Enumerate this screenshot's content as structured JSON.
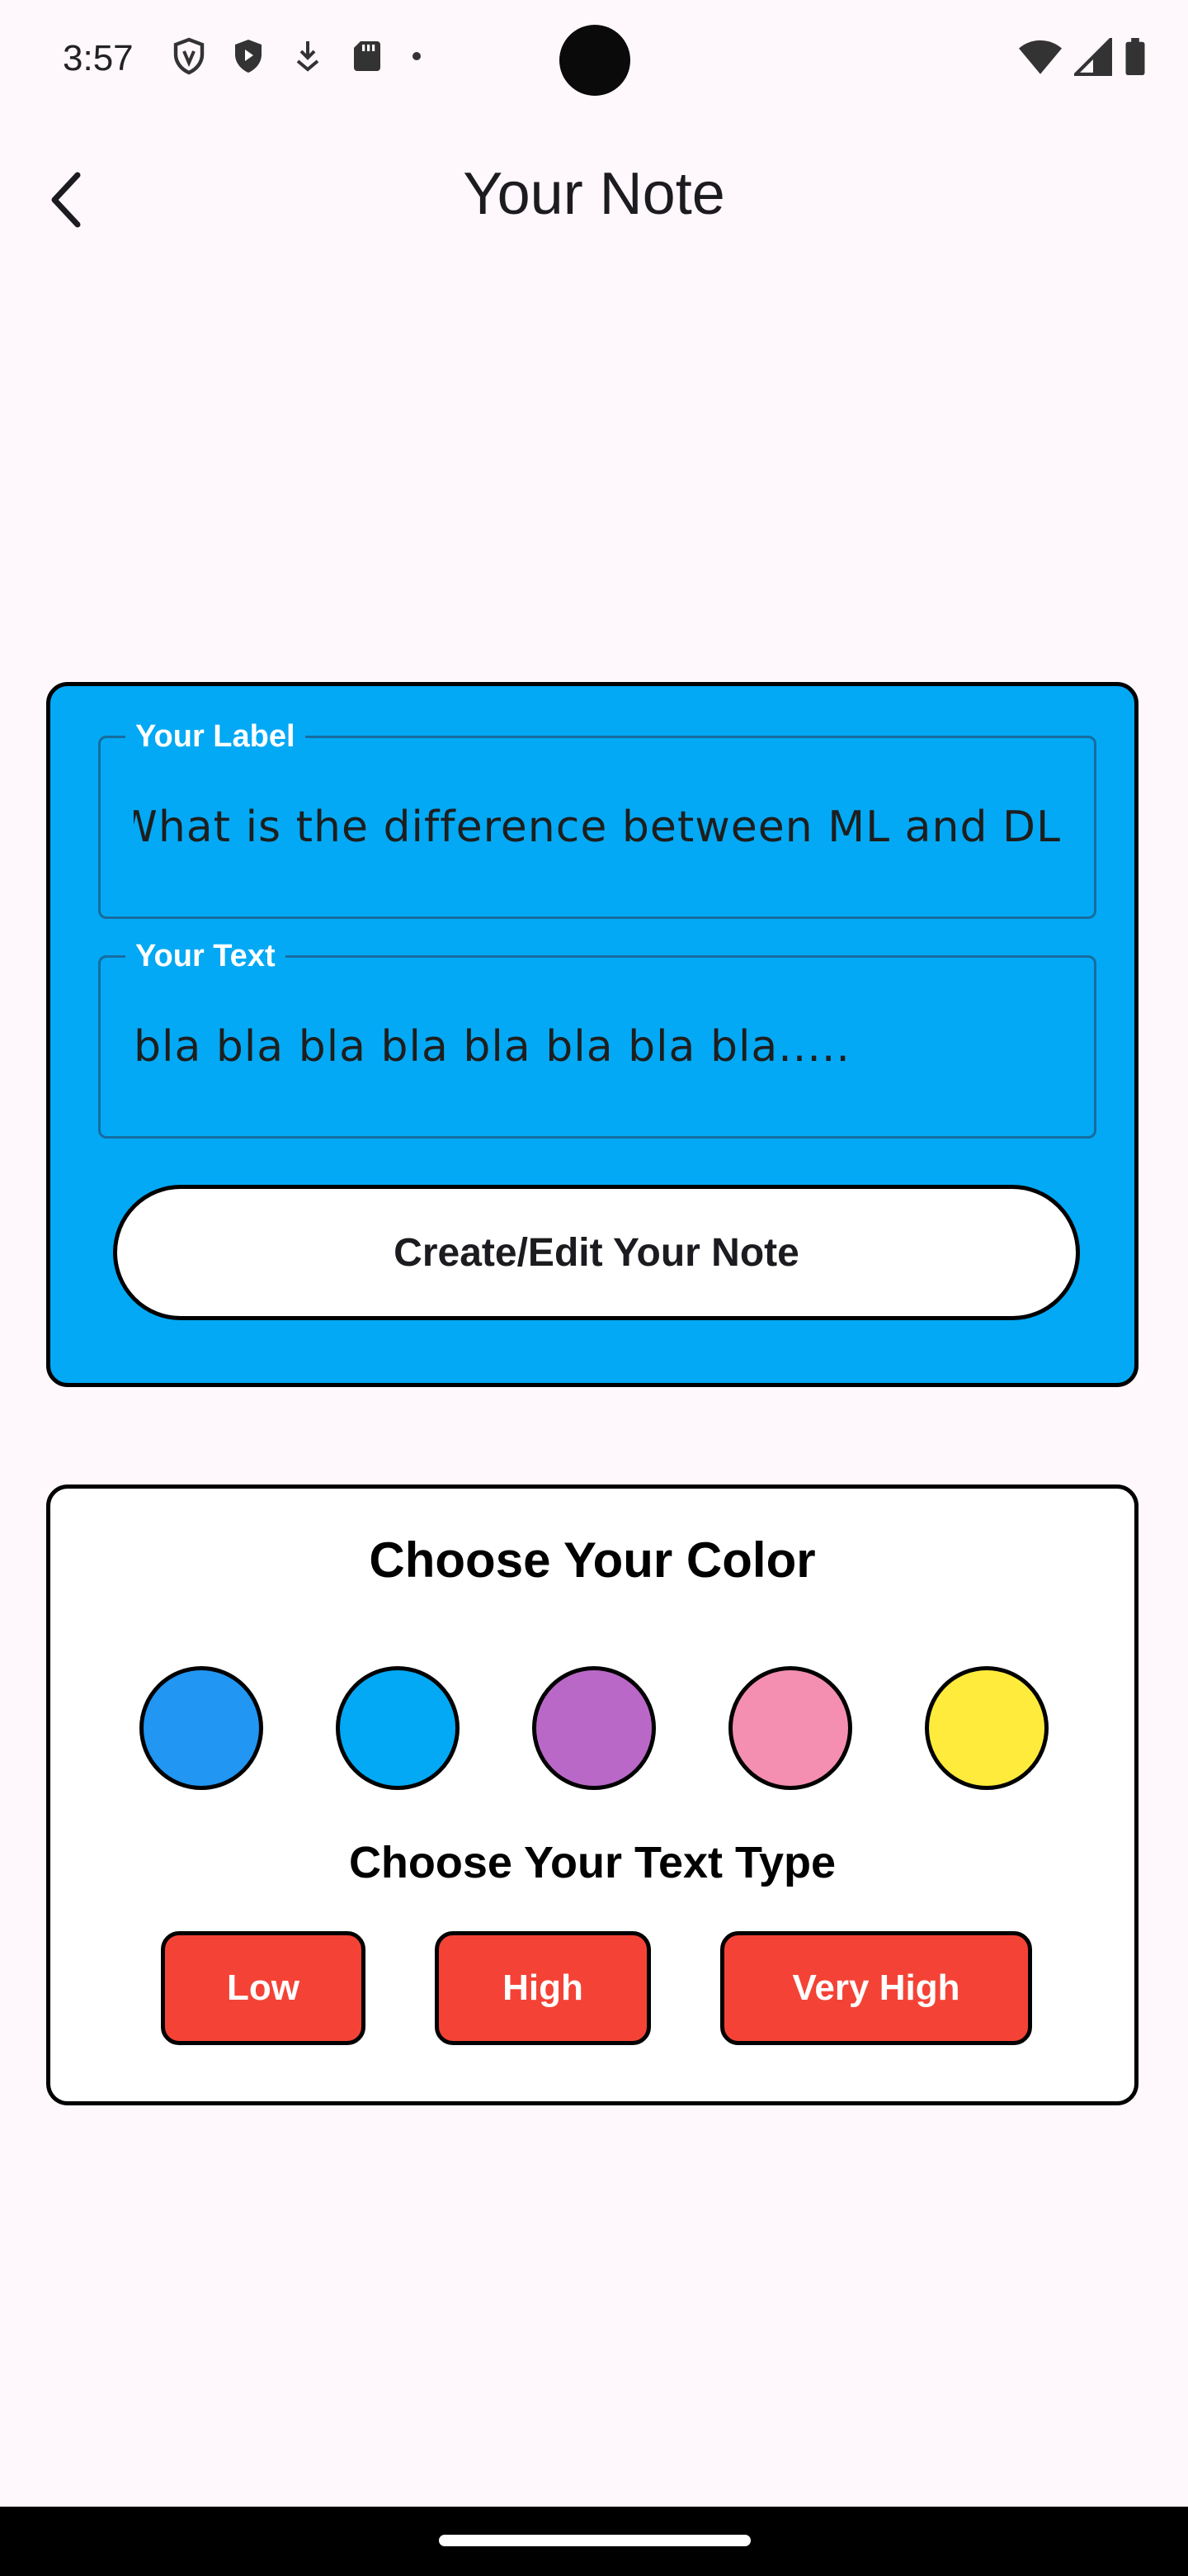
{
  "status_bar": {
    "time": "3:57",
    "left_icons": [
      "vpn-shield-icon",
      "play-protect-icon",
      "download-icon",
      "sd-card-icon",
      "dot-icon"
    ],
    "right_icons": [
      "wifi-icon",
      "cell-signal-icon",
      "battery-icon"
    ]
  },
  "app_bar": {
    "back_icon": "chevron-left-icon",
    "title": "Your Note"
  },
  "form": {
    "background_color": "#03a9f4",
    "label_field": {
      "label": "Your Label",
      "value": "What is the difference between ML and DL?"
    },
    "text_field": {
      "label": "Your Text",
      "value": "bla bla bla bla bla bla bla bla....."
    },
    "submit_label": "Create/Edit Your Note"
  },
  "options": {
    "color_title": "Choose Your Color",
    "colors": [
      "#2196f3",
      "#03a9f4",
      "#ba68c8",
      "#f48fb1",
      "#ffeb3b"
    ],
    "type_title": "Choose Your Text Type",
    "type_buttons": [
      {
        "label": "Low"
      },
      {
        "label": "High"
      },
      {
        "label": "Very High"
      }
    ],
    "type_button_color": "#f44336"
  }
}
